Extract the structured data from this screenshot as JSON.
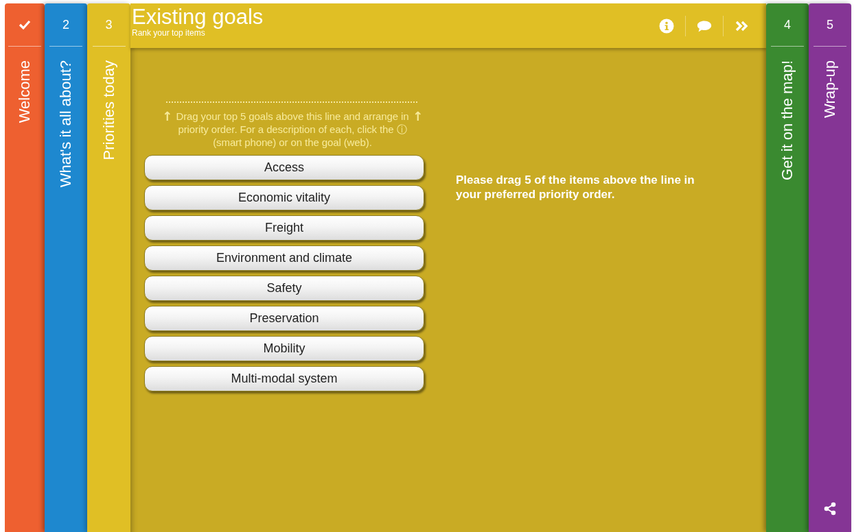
{
  "steps_left": [
    {
      "number": "2",
      "label": "What's it all about?",
      "color": "#1e88cf",
      "done": false,
      "selected": false
    },
    {
      "number": "3",
      "label": "Priorities today",
      "color": "#e0bf25",
      "done": false,
      "selected": true
    }
  ],
  "first_step": {
    "label": "Welcome",
    "color": "#ee6030",
    "done": true,
    "selected": false
  },
  "header": {
    "title": "Existing goals",
    "subtitle": "Rank your top items"
  },
  "instructions": {
    "arrow_left": "↑",
    "text": "Drag your top 5 goals above this line and arrange in priority order. For a description of each, click the ⓘ (smart phone) or on the goal (web).",
    "arrow_right": "↑"
  },
  "goals": [
    {
      "label": "Access"
    },
    {
      "label": "Economic vitality"
    },
    {
      "label": "Freight"
    },
    {
      "label": "Environment and climate"
    },
    {
      "label": "Safety"
    },
    {
      "label": "Preservation"
    },
    {
      "label": "Mobility"
    },
    {
      "label": "Multi-modal system"
    }
  ],
  "message": "Please drag 5 of the items above the line in your preferred priority order.",
  "steps_right": [
    {
      "number": "4",
      "label": "Get it on the map!",
      "color": "#3a8a30",
      "done": false,
      "selected": false,
      "share": false
    },
    {
      "number": "5",
      "label": "Wrap-up",
      "color": "#853595",
      "done": false,
      "selected": false,
      "share": true
    }
  ]
}
